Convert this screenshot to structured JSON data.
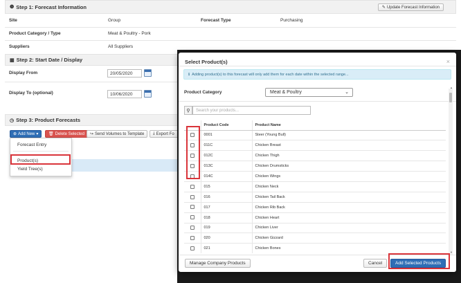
{
  "step1": {
    "title": "Step 1: Forecast Information",
    "update_button": "Update Forecast Information",
    "site_label": "Site",
    "site_value": "Group",
    "forecast_type_label": "Forecast Type",
    "forecast_type_value": "Purchasing",
    "category_label": "Product Category / Type",
    "category_value": "Meat & Poultry - Pork",
    "suppliers_label": "Suppliers",
    "suppliers_value": "All Suppliers"
  },
  "step2": {
    "title": "Step 2: Start Date / Display",
    "display_from_label": "Display From",
    "display_from_value": "20/05/2020",
    "display_to_label": "Display To (optional)",
    "display_to_value": "10/06/2020"
  },
  "step3": {
    "title": "Step 3: Product Forecasts",
    "add_new": "Add New",
    "delete_selected": "Delete Selected",
    "send_volumes": "Send Volumes to Template",
    "export": "Export Fo",
    "dropdown": {
      "forecast_entry": "Forecast Entry",
      "products": "Product(s)",
      "yield_trees": "Yield Tree(s)"
    }
  },
  "modal": {
    "title": "Select Product(s)",
    "close": "×",
    "info": "Adding product(s) to this forecast will only add them for each date within the selected range...",
    "category_label": "Product Category",
    "category_value": "Meat & Poultry",
    "search_placeholder": "Search your products...",
    "col_code": "Product Code",
    "col_name": "Product Name",
    "rows": [
      {
        "code": "0001",
        "name": "Steer (Young Bull)"
      },
      {
        "code": "011C",
        "name": "Chicken Breast"
      },
      {
        "code": "012C",
        "name": "Chicken Thigh"
      },
      {
        "code": "013C",
        "name": "Chicken Drumsticks"
      },
      {
        "code": "014C",
        "name": "Chicken Wings"
      },
      {
        "code": "015",
        "name": "Chicken Neck"
      },
      {
        "code": "016",
        "name": "Chicken Tail Back"
      },
      {
        "code": "017",
        "name": "Chicken Rib Back"
      },
      {
        "code": "018",
        "name": "Chicken Heart"
      },
      {
        "code": "019",
        "name": "Chicken Liver"
      },
      {
        "code": "020",
        "name": "Chicken Gizzard"
      },
      {
        "code": "021",
        "name": "Chicken Bones"
      },
      {
        "code": "022",
        "name": "Chicken Skin"
      }
    ],
    "manage_button": "Manage Company Products",
    "cancel_button": "Cancel",
    "add_button": "Add Selected Products"
  }
}
